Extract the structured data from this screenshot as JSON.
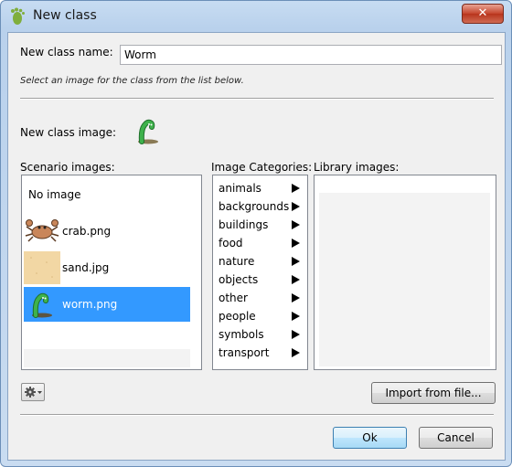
{
  "window": {
    "title": "New class",
    "close_label": "✕"
  },
  "form": {
    "name_label": "New class name:",
    "name_value": "Worm",
    "hint": "Select an image for the class from the list below.",
    "image_label": "New class image:"
  },
  "scenario": {
    "label": "Scenario images:",
    "items": [
      {
        "label": "No image",
        "icon": "none"
      },
      {
        "label": "crab.png",
        "icon": "crab-icon"
      },
      {
        "label": "sand.jpg",
        "icon": "sand-icon"
      },
      {
        "label": "worm.png",
        "icon": "worm-icon",
        "selected": true
      }
    ]
  },
  "categories": {
    "label": "Image Categories:",
    "items": [
      "animals",
      "backgrounds",
      "buildings",
      "food",
      "nature",
      "objects",
      "other",
      "people",
      "symbols",
      "transport"
    ]
  },
  "library": {
    "label": "Library images:"
  },
  "buttons": {
    "import": "Import from file...",
    "ok": "Ok",
    "cancel": "Cancel"
  },
  "colors": {
    "selection": "#3399ff",
    "worm": "#2f9a3a"
  }
}
